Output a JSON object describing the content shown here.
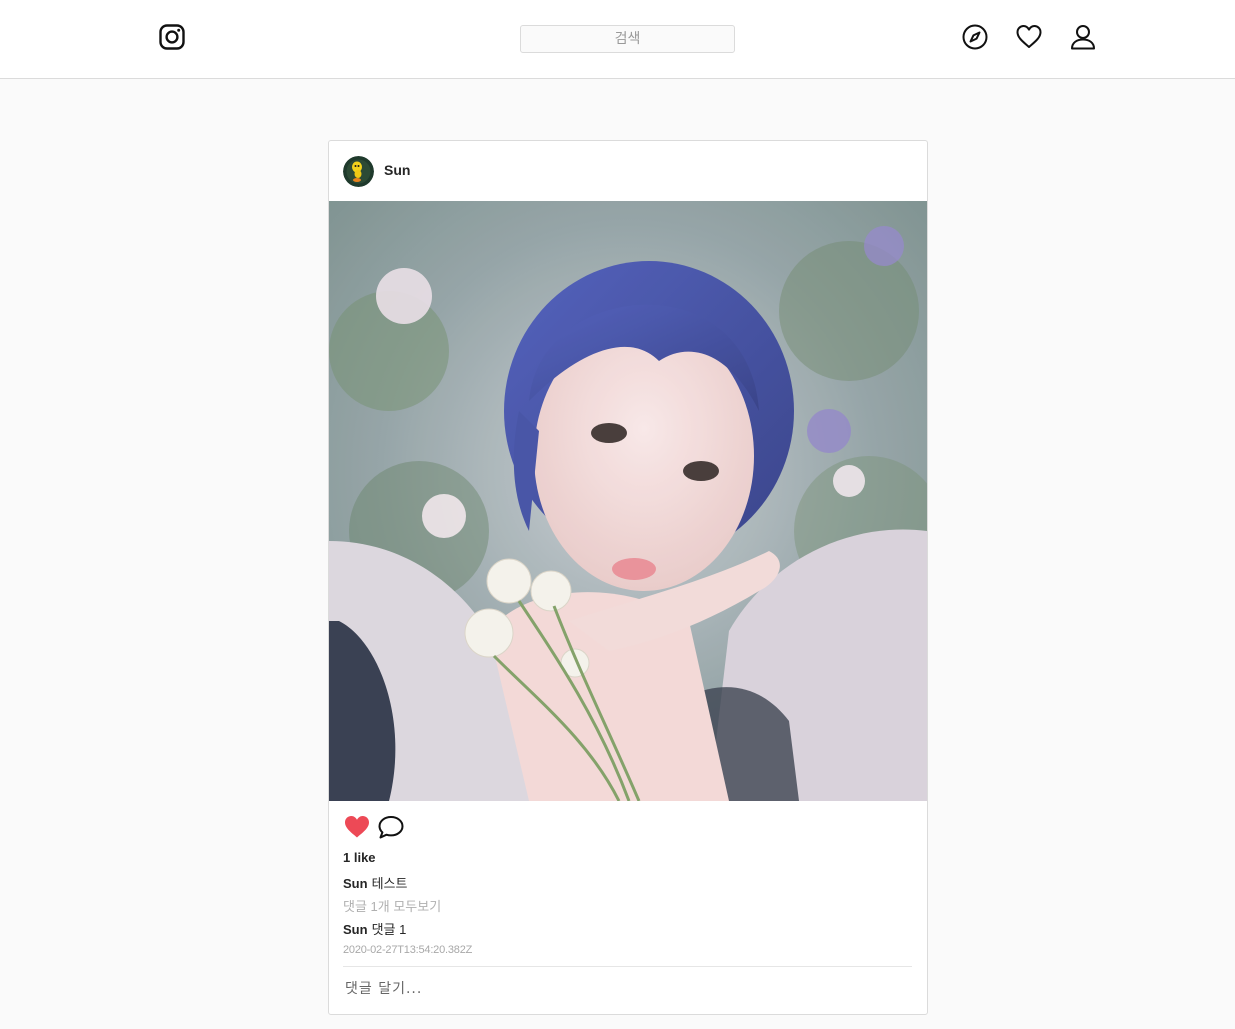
{
  "header": {
    "logo_icon": "instagram-icon",
    "search_placeholder": "검색",
    "nav": [
      {
        "icon": "compass-icon"
      },
      {
        "icon": "heart-outline-icon"
      },
      {
        "icon": "user-icon"
      }
    ]
  },
  "post": {
    "username": "Sun",
    "avatar_icon": "avatar-icon",
    "liked": true,
    "like_color": "#ed4956",
    "likes_text": "1 like",
    "caption": {
      "username": "Sun",
      "text": "테스트"
    },
    "view_all_comments": "댓글 1개 모두보기",
    "comments": [
      {
        "username": "Sun",
        "text": "댓글 1"
      }
    ],
    "timestamp": "2020-02-27T13:54:20.382Z",
    "comment_placeholder": "댓글 달기..."
  }
}
